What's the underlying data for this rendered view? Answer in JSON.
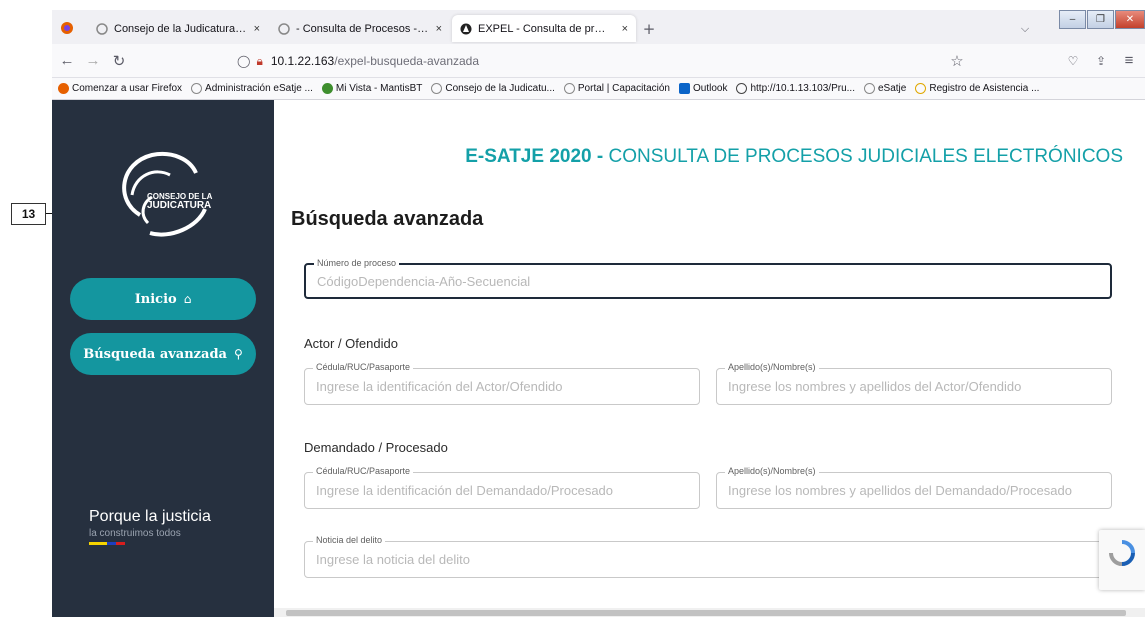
{
  "browser": {
    "tabs": [
      {
        "title": "Consejo de la Judicatura | Cons",
        "active": false
      },
      {
        "title": "- Consulta de Procesos - eSATJ",
        "active": false
      },
      {
        "title": "EXPEL - Consulta de procesos",
        "active": true
      }
    ],
    "new_tab": "+",
    "tab_list_icon": "chevron-down-icon",
    "url_host": "10.1.22.163",
    "url_path": "/expel-busqueda-avanzada",
    "bookmarks": [
      "Comenzar a usar Firefox",
      "Administración eSatje ...",
      "Mi Vista - MantisBT",
      "Consejo de la Judicatu...",
      "Portal | Capacitación",
      "Outlook",
      "http://10.1.13.103/Pru...",
      "eSatje",
      "Registro de Asistencia ..."
    ]
  },
  "sidebar": {
    "logo_line1": "CONSEJO DE LA",
    "logo_line2": "JUDICATURA",
    "buttons": [
      {
        "label": "Inicio",
        "icon": "⌂"
      },
      {
        "label": "Búsqueda avanzada",
        "icon": "⚲"
      }
    ],
    "slogan_main": "Porque la justicia",
    "slogan_sub": "la construimos todos",
    "flag_colors": [
      "#f5d300",
      "#1d3fbf",
      "#d81e1e"
    ]
  },
  "main": {
    "header_strong": "E-SATJE 2020 -",
    "header_rest": " CONSULTA DE PROCESOS JUDICIALES ELECTRÓNICOS",
    "section_title": "Búsqueda avanzada",
    "numero": {
      "label": "Número de proceso",
      "placeholder": "CódigoDependencia-Año-Secuencial"
    },
    "actor": {
      "title": "Actor / Ofendido",
      "id_label": "Cédula/RUC/Pasaporte",
      "id_placeholder": "Ingrese la identificación del Actor/Ofendido",
      "name_label": "Apellido(s)/Nombre(s)",
      "name_placeholder": "Ingrese los nombres y apellidos del Actor/Ofendido"
    },
    "demandado": {
      "title": "Demandado / Procesado",
      "id_label": "Cédula/RUC/Pasaporte",
      "id_placeholder": "Ingrese la identificación del Demandado/Procesado",
      "name_label": "Apellido(s)/Nombre(s)",
      "name_placeholder": "Ingrese los nombres y apellidos del Demandado/Procesado"
    },
    "noticia": {
      "label": "Noticia del delito",
      "placeholder": "Ingrese la noticia del delito"
    }
  },
  "callout": {
    "number": "13"
  },
  "colors": {
    "accent": "#14969f",
    "sidebar": "#26303f",
    "header": "#14a0a8"
  }
}
